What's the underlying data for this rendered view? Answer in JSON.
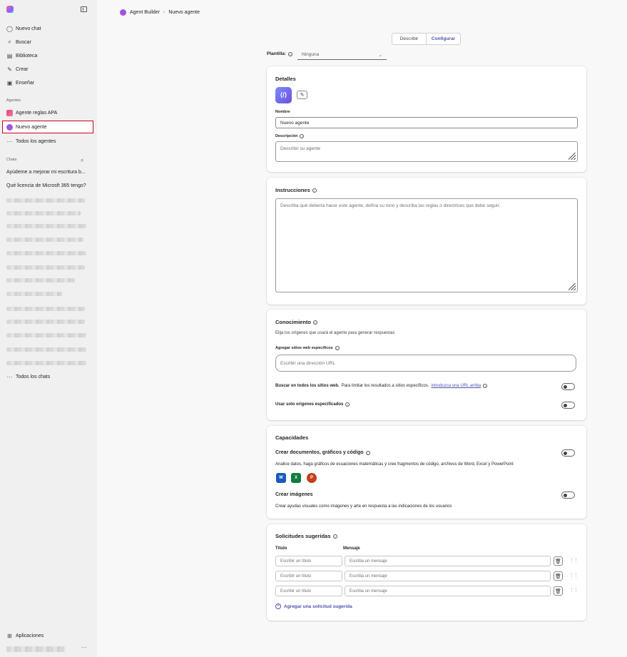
{
  "sidebar": {
    "nav": [
      {
        "icon": "chat-bubble-icon",
        "label": "Nuevo chat"
      },
      {
        "icon": "search-icon",
        "label": "Buscar"
      },
      {
        "icon": "library-icon",
        "label": "Biblioteca"
      },
      {
        "icon": "create-icon",
        "label": "Crear"
      },
      {
        "icon": "teach-icon",
        "label": "Enseñar"
      }
    ],
    "agents_heading": "Agentes",
    "agents": [
      {
        "label": "Agente reglas APA"
      },
      {
        "label": "Nuevo agente"
      }
    ],
    "all_agents": "Todos los agentes",
    "chats_heading": "Chats",
    "chats": [
      "Ayúdeme a mejorar mi escritura b...",
      "Qué licencia de Microsft 365 tengo?"
    ],
    "all_chats": "Todos los chats",
    "apps": "Aplicaciones"
  },
  "breadcrumb": {
    "root": "Agent Builder",
    "separator": "›",
    "current": "Nuevo agente"
  },
  "tabs": [
    {
      "label": "Describir"
    },
    {
      "label": "Configurar"
    }
  ],
  "template": {
    "label": "Plantilla:",
    "value": "Ninguna"
  },
  "details": {
    "title": "Detalles",
    "name_label": "Nombre",
    "name_value": "Nuevo agente",
    "description_label": "Descripción",
    "description_placeholder": "Describir su agente"
  },
  "instructions": {
    "title": "Instrucciones",
    "placeholder": "Describa qué debería hacer este agente, defina su tono y describa las reglas o directrices que debe seguir."
  },
  "knowledge": {
    "title": "Conocimiento",
    "subtitle": "Elija los orígenes que usará el agente para generar respuestas",
    "sites_label": "Agregar sitios web específicos",
    "url_placeholder": "Escribir una dirección URL",
    "search_all_bold": "Buscar en todos los sitios web.",
    "search_all_text": "Para limitar los resultados a sitios específicos,",
    "search_all_link": "introduzca una URL arriba",
    "only_specified": "Usar solo orígenes especificados"
  },
  "capabilities": {
    "title": "Capacidades",
    "docs_title": "Crear documentos, gráficos y código",
    "docs_desc": "Analice datos, haga gráficos de ecuaciones matemáticas y cree fragmentos de código, archivos de Word, Excel y PowerPoint",
    "apps": [
      {
        "name": "word-icon",
        "letter": "W",
        "color": "#185abd"
      },
      {
        "name": "excel-icon",
        "letter": "X",
        "color": "#107c41"
      },
      {
        "name": "powerpoint-icon",
        "letter": "P",
        "color": "#c43e1c"
      }
    ],
    "images_title": "Crear imágenes",
    "images_desc": "Crear ayudas visuales como imágenes y arte en respuesta a las indicaciones de los usuarios"
  },
  "prompts": {
    "title": "Solicitudes sugeridas",
    "col_title": "Título",
    "col_message": "Mensaje",
    "title_placeholder": "Escribir un título",
    "message_placeholder": "Escriba un mensaje",
    "add": "Agregar una solicitud sugerida"
  }
}
